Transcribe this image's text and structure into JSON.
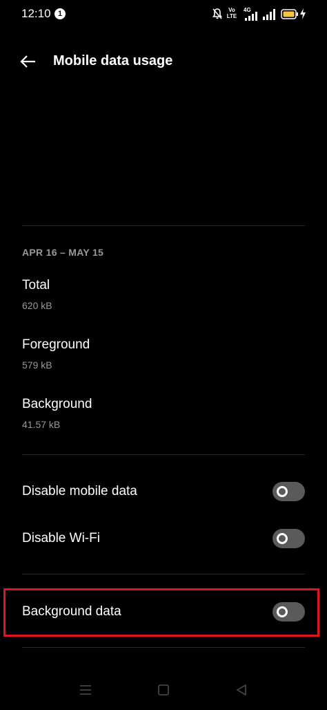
{
  "status_bar": {
    "time": "12:10",
    "notification_count": "1",
    "volte_label": "Vo LTE",
    "network_label": "4G",
    "battery_color": "#f5c542"
  },
  "header": {
    "back_icon": "arrow-left-icon",
    "title": "Mobile data usage"
  },
  "usage": {
    "period": "APR 16 – MAY 15",
    "items": [
      {
        "label": "Total",
        "value": "620 kB"
      },
      {
        "label": "Foreground",
        "value": "579 kB"
      },
      {
        "label": "Background",
        "value": "41.57 kB"
      }
    ]
  },
  "settings": {
    "items": [
      {
        "label": "Disable mobile data",
        "enabled": false
      },
      {
        "label": "Disable Wi-Fi",
        "enabled": false
      },
      {
        "label": "Background data",
        "enabled": false
      }
    ]
  },
  "highlight_color": "#e0161d",
  "nav_bar": {
    "icons": [
      "menu-icon",
      "home-square-icon",
      "back-triangle-icon"
    ]
  }
}
